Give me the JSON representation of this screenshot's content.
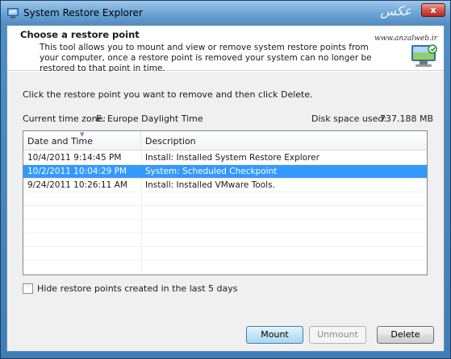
{
  "window": {
    "title": "System Restore Explorer",
    "watermark": "ﻋﻜﺲ",
    "close_label": "x"
  },
  "header": {
    "title": "Choose a restore point",
    "description": "This tool allows you to mount and view or remove system restore points from your computer, once a restore point is removed your system can no longer be restored to that point in time.",
    "site": "www.anzalweb.ir"
  },
  "main": {
    "instruction": "Click the restore point you want to remove and then click Delete.",
    "timezone_label": "Current time zone:",
    "timezone_value": "E. Europe Daylight Time",
    "disk_label": "Disk space used:",
    "disk_value": "737.188 MB"
  },
  "table": {
    "columns": [
      "Date and Time",
      "Description"
    ],
    "rows": [
      {
        "date": "10/4/2011 9:14:45 PM",
        "description": "Install: Installed System Restore Explorer",
        "selected": false
      },
      {
        "date": "10/2/2011 10:04:29 PM",
        "description": "System: Scheduled Checkpoint",
        "selected": true
      },
      {
        "date": "9/24/2011 10:26:11 AM",
        "description": "Install: Installed VMware Tools.",
        "selected": false
      }
    ]
  },
  "options": {
    "hide_recent_label": "Hide restore points created in the last 5 days",
    "hide_recent_checked": false
  },
  "buttons": {
    "mount": "Mount",
    "unmount": "Unmount",
    "delete": "Delete"
  },
  "colors": {
    "selection": "#3399ff",
    "titlebar": "#6ea6d6"
  },
  "icons": {
    "app": "restore-app-icon",
    "header": "computer-restore-icon",
    "sort": "sort-ascending-icon",
    "close": "close-icon"
  }
}
